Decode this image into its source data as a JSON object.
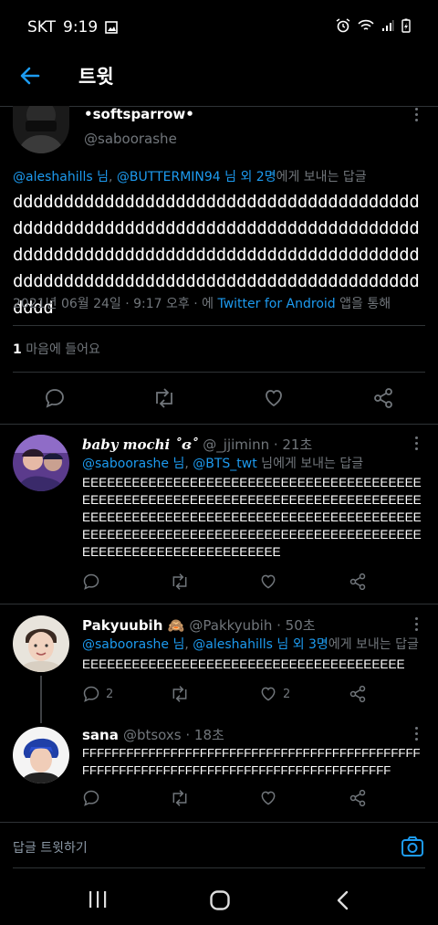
{
  "status": {
    "carrier": "SKT",
    "time": "9:19"
  },
  "header": {
    "title": "트윗"
  },
  "main_tweet": {
    "display_name": "•softsparrow•",
    "handle": "@saboorashe",
    "reply_to": {
      "mention1": "@aleshahills 님",
      "sep": ", ",
      "mention2": "@BUTTERMIN94 님 외 2명",
      "suffix": "에게 보내는 답글"
    },
    "text": "dddddddddddddddddddddddddddddddddddddddddddddddddddddddddddddddddddddddddddddddddddddddddddddddddddddddddddddddddddddddddddddddddddddddddddddddddddddddddddddddddddd",
    "timestamp": "2021년 06월 24일 · 9:17 오후 · 에 ",
    "source": "Twitter for Android",
    "source_suffix": " 앱을 통해",
    "likes_count": "1",
    "likes_label": " 마음에 들어요"
  },
  "replies": [
    {
      "display_name": "baby mochi ˚ɞ˚",
      "handle": "@_jjiminn",
      "time": " · 21초",
      "reply_mention1": "@saboorashe 님",
      "reply_sep": ", ",
      "reply_mention2": "@BTS_twt",
      "reply_suffix": " 님에게 보내는 답글",
      "text": "EEEEEEEEEEEEEEEEEEEEEEEEEEEEEEEEEEEEEEEEEEEEEEEEEEEEEEEEEEEEEEEEEEEEEEEEEEEEEEEEEEEEEEEEEEEEEEEEEEEEEEEEEEEEEEEEEEEEEEEEEEEEEEEEEEEEEEEEEEEEEEEEEEEEEEEEEEEEEEEEEEEEEEEEEEEEEEEEEEEEEEEEEEEE"
    },
    {
      "display_name": "Pakyuubih 🙈",
      "handle": "@Pakkyubih",
      "time": " · 50초",
      "reply_mention1": "@saboorashe 님",
      "reply_sep": ", ",
      "reply_mention2": "@aleshahills 님 외 3명",
      "reply_suffix": "에게 보내는 답글",
      "text": "EEEEEEEEEEEEEEEEEEEEEEEEEEEEEEEEEEEEEEE",
      "reply_count": "2",
      "like_count": "2"
    },
    {
      "display_name": "sana",
      "handle": "@btsoxs",
      "time": " · 18초",
      "text": "FFFFFFFFFFFFFFFFFFFFFFFFFFFFFFFFFFFFFFFFFFFFFFFFFFFFFFFFFFFFFFFFFFFFFFFFFFFFFFFFFFFFFFFF"
    }
  ],
  "compose": {
    "placeholder": "답글 트윗하기"
  },
  "colors": {
    "accent": "#1d9bf0",
    "background": "#000000",
    "divider": "#2f3336",
    "muted": "#71767b"
  }
}
